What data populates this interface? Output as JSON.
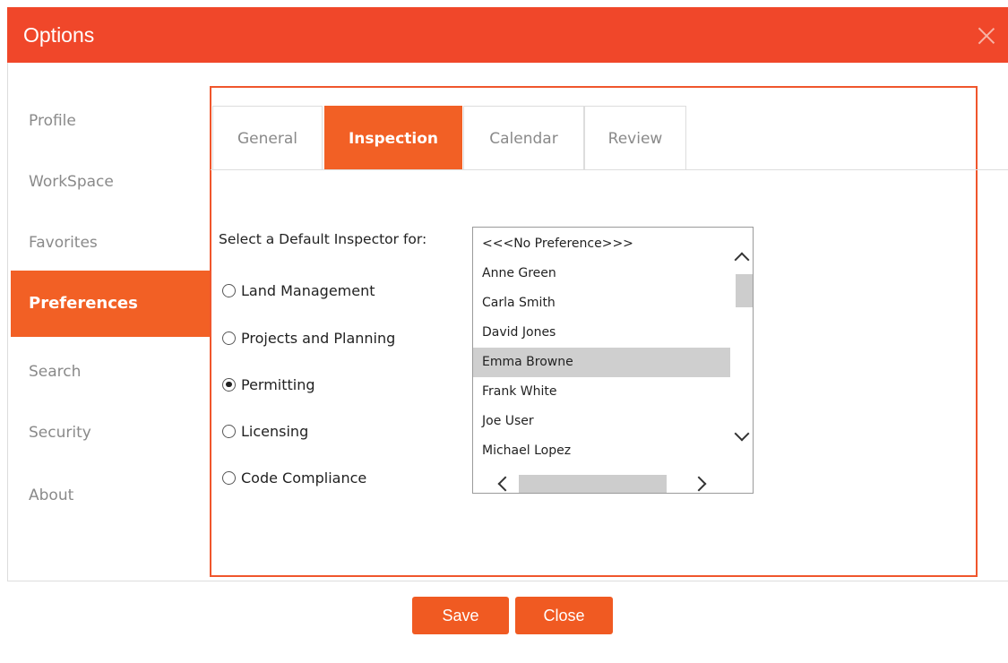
{
  "window": {
    "title": "Options"
  },
  "sidebar": {
    "items": [
      {
        "label": "Profile"
      },
      {
        "label": "WorkSpace"
      },
      {
        "label": "Favorites"
      },
      {
        "label": "Preferences",
        "active": true
      },
      {
        "label": "Search"
      },
      {
        "label": "Security"
      },
      {
        "label": "About"
      }
    ]
  },
  "tabs": [
    {
      "label": "General"
    },
    {
      "label": "Inspection",
      "active": true
    },
    {
      "label": "Calendar"
    },
    {
      "label": "Review"
    }
  ],
  "inspection": {
    "prompt": "Select a Default Inspector for:",
    "modules": [
      {
        "label": "Land Management",
        "checked": false
      },
      {
        "label": "Projects and Planning",
        "checked": false
      },
      {
        "label": "Permitting",
        "checked": true
      },
      {
        "label": "Licensing",
        "checked": false
      },
      {
        "label": "Code Compliance",
        "checked": false
      }
    ],
    "inspectors": [
      {
        "label": "<<<No Preference>>>"
      },
      {
        "label": "Anne Green"
      },
      {
        "label": "Carla Smith"
      },
      {
        "label": "David Jones"
      },
      {
        "label": "Emma Browne",
        "selected": true
      },
      {
        "label": "Frank White"
      },
      {
        "label": "Joe User"
      },
      {
        "label": "Michael Lopez"
      }
    ]
  },
  "buttons": {
    "save": "Save",
    "close": "Close"
  },
  "colors": {
    "accent": "#f26025",
    "titlebar": "#f0472a"
  },
  "icons": {
    "close": "close-icon",
    "scroll_up": "chevron-up-icon",
    "scroll_down": "chevron-down-icon",
    "scroll_left": "chevron-left-icon",
    "scroll_right": "chevron-right-icon"
  }
}
